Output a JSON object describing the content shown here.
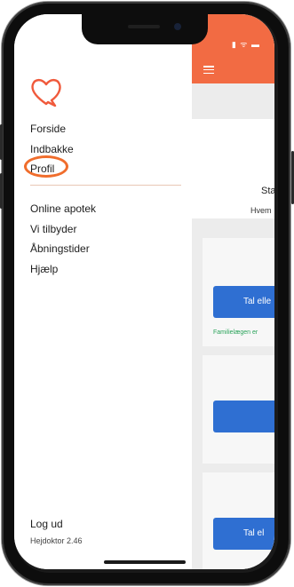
{
  "drawer": {
    "logo_icon": "heart-chat-icon",
    "primary_items": [
      {
        "label": "Forside"
      },
      {
        "label": "Indbakke"
      },
      {
        "label": "Profil"
      }
    ],
    "secondary_items": [
      {
        "label": "Online apotek"
      },
      {
        "label": "Vi tilbyder"
      },
      {
        "label": "Åbningstider"
      },
      {
        "label": "Hjælp"
      }
    ],
    "logout_label": "Log ud",
    "version": "Hejdoktor 2.46"
  },
  "main": {
    "menu_icon": "hamburger-icon",
    "card_title": "Sta",
    "card_sub": "Hvem",
    "button_1": "Tal elle",
    "note": "Familielægen er",
    "button_2": "",
    "button_3": "Tal el"
  },
  "colors": {
    "accent_orange": "#f26b43",
    "button_blue": "#2f6fd2",
    "note_green": "#2aa35a"
  }
}
